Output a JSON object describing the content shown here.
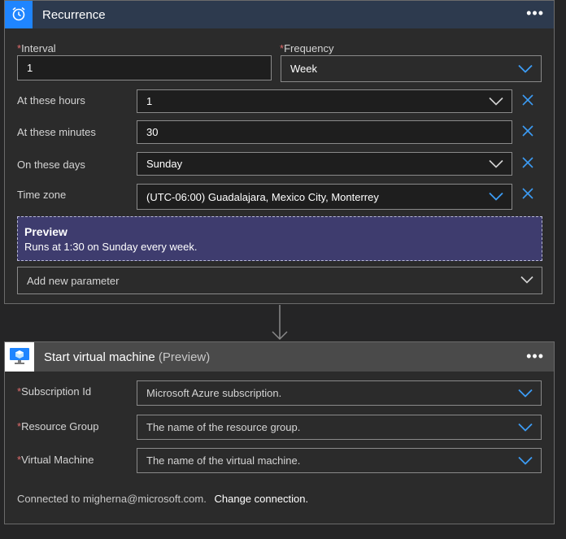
{
  "recurrence": {
    "title": "Recurrence",
    "more_label": "•••",
    "interval": {
      "label": "Interval",
      "value": "1"
    },
    "frequency": {
      "label": "Frequency",
      "value": "Week"
    },
    "hours": {
      "label": "At these hours",
      "value": "1"
    },
    "minutes": {
      "label": "At these minutes",
      "value": "30"
    },
    "days": {
      "label": "On these days",
      "value": "Sunday"
    },
    "timezone": {
      "label": "Time zone",
      "value": "(UTC-06:00) Guadalajara, Mexico City, Monterrey"
    },
    "preview": {
      "title": "Preview",
      "text": "Runs at 1:30 on Sunday every week."
    },
    "add_param": "Add new parameter"
  },
  "vm": {
    "title": "Start virtual machine",
    "title_suffix": "(Preview)",
    "more_label": "•••",
    "subscription": {
      "label": "Subscription Id",
      "placeholder": "Microsoft Azure subscription."
    },
    "resource_group": {
      "label": "Resource Group",
      "placeholder": "The name of the resource group."
    },
    "virtual_machine": {
      "label": "Virtual Machine",
      "placeholder": "The name of the virtual machine."
    },
    "connected_text": "Connected to migherna@microsoft.com.",
    "change_connection": "Change connection."
  },
  "required_marker": "*",
  "colors": {
    "recurrence_header": "#2d3a4e",
    "recurrence_icon_bg": "#1f85ff",
    "vm_header": "#4a4a4a",
    "accent_blue": "#3c9cf5",
    "preview_bg": "#3e3c6e"
  }
}
